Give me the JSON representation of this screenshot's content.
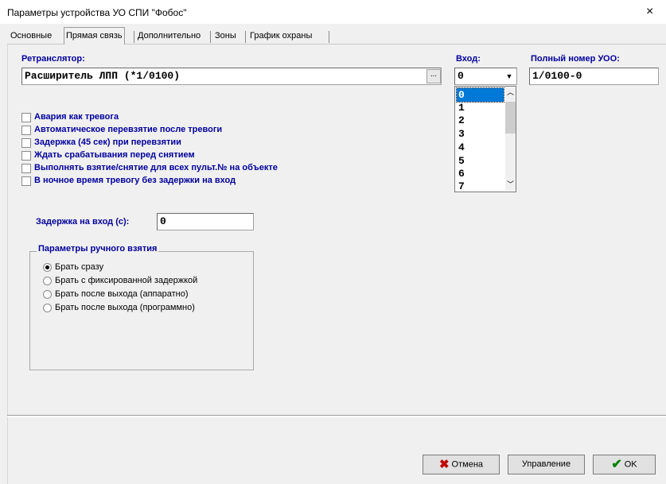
{
  "window": {
    "title": "Параметры устройства УО СПИ \"Фобос\"",
    "close_glyph": "×"
  },
  "tabs": [
    {
      "label": "Основные",
      "active": false
    },
    {
      "label": "Прямая связь",
      "active": true
    },
    {
      "label": "Дополнительно",
      "active": false
    },
    {
      "label": "Зоны",
      "active": false
    },
    {
      "label": "График охраны",
      "active": false
    }
  ],
  "relay": {
    "label": "Ретранслятор:",
    "value": "Расширитель ЛПП (*1/0100)",
    "browse_label": "..."
  },
  "input": {
    "label": "Вход:",
    "value": "0",
    "options": [
      "0",
      "1",
      "2",
      "3",
      "4",
      "5",
      "6",
      "7"
    ],
    "selected_index": 0
  },
  "full_number": {
    "label": "Полный номер УОО:",
    "value": "1/0100-0"
  },
  "checkboxes": [
    {
      "label": "Авария как тревога",
      "checked": false
    },
    {
      "label": "Автоматическое перевзятие после тревоги",
      "checked": false
    },
    {
      "label": "Задержка (45 сек) при перевзятии",
      "checked": false
    },
    {
      "label": "Ждать срабатывания перед снятием",
      "checked": false
    },
    {
      "label": "Выполнять взятие/снятие для всех пульт.№ на объекте",
      "checked": false
    },
    {
      "label": "В ночное время тревогу без задержки на вход",
      "checked": false
    }
  ],
  "entry_delay": {
    "label": "Задержка на вход (с):",
    "value": "0"
  },
  "manual_arming": {
    "title": "Параметры ручного взятия",
    "options": [
      {
        "label": "Брать сразу",
        "selected": true
      },
      {
        "label": "Брать с фиксированной задержкой",
        "selected": false
      },
      {
        "label": "Брать после выхода (аппаратно)",
        "selected": false
      },
      {
        "label": "Брать после выхода (программно)",
        "selected": false
      }
    ]
  },
  "buttons": {
    "cancel": "Отмена",
    "control": "Управление",
    "ok": "OK"
  },
  "colors": {
    "label_blue": "#0000a0",
    "selection": "#0078d7",
    "cancel_icon": "#c00000",
    "ok_icon": "#008000"
  }
}
